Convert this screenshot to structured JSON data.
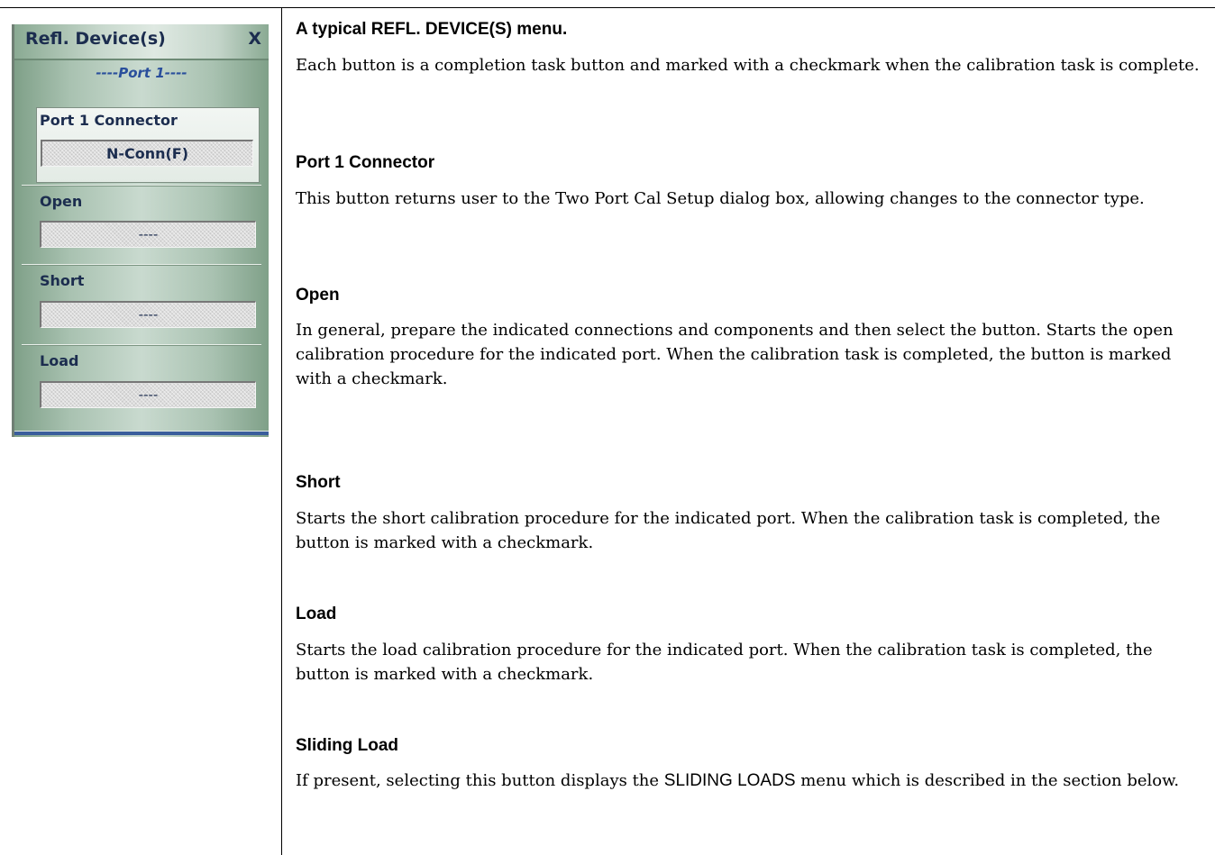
{
  "menu": {
    "title": "Refl. Device(s)",
    "close_label": "X",
    "port_label": "----Port 1----",
    "connector": {
      "label": "Port 1 Connector",
      "value": "N-Conn(F)"
    },
    "items": [
      {
        "label": "Open",
        "value": "----"
      },
      {
        "label": "Short",
        "value": "----"
      },
      {
        "label": "Load",
        "value": "----"
      }
    ]
  },
  "doc": {
    "caption": "A typical REFL. DEVICE(S) menu.",
    "intro": "Each button is a completion task button and marked with a checkmark when the calibration task is complete.",
    "sections": [
      {
        "heading": "Port 1 Connector",
        "body": "This button returns user to the Two Port Cal Setup dialog box, allowing changes to the connector type."
      },
      {
        "heading": "Open",
        "body": "In general, prepare the indicated connections and components and then select the button. Starts the open calibration procedure for the indicated port. When the calibration task is completed, the button is marked with a checkmark."
      },
      {
        "heading": "Short",
        "body": "Starts the short calibration procedure for the indicated port. When the calibration task is completed, the button is marked with a checkmark."
      },
      {
        "heading": "Load",
        "body": "Starts the load calibration procedure for the indicated port. When the calibration task is completed, the button is marked with a checkmark."
      },
      {
        "heading": "Sliding Load",
        "body_pre": "If present, selecting this button displays the ",
        "body_keyword": "SLIDING LOADS",
        "body_post": " menu which is described in the section below."
      }
    ]
  }
}
